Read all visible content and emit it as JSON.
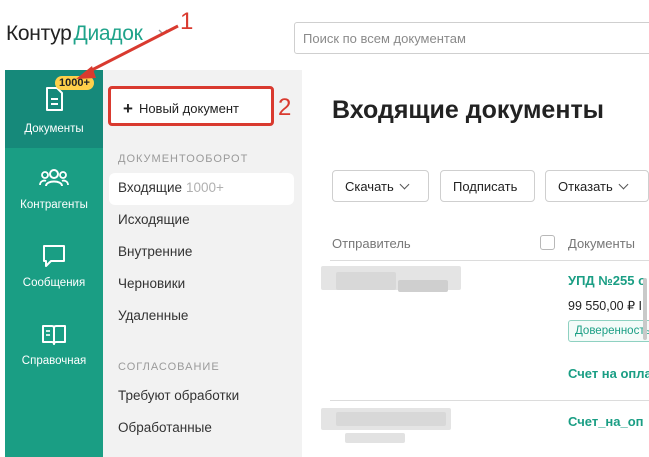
{
  "header": {
    "logo_kontur": "Контур",
    "logo_diadoc": "Диадок",
    "search_placeholder": "Поиск по всем документам"
  },
  "sidebar": {
    "items": [
      {
        "label": "Документы",
        "badge": "1000+",
        "icon": "document-icon"
      },
      {
        "label": "Контрагенты",
        "icon": "users-icon"
      },
      {
        "label": "Сообщения",
        "icon": "message-icon"
      },
      {
        "label": "Справочная",
        "icon": "book-icon"
      }
    ]
  },
  "subnav": {
    "new_document": "Новый документ",
    "section_docflow": "ДОКУМЕНТООБОРОТ",
    "docflow_items": [
      {
        "label": "Входящие",
        "count": "1000+"
      },
      {
        "label": "Исходящие"
      },
      {
        "label": "Внутренние"
      },
      {
        "label": "Черновики"
      },
      {
        "label": "Удаленные"
      }
    ],
    "section_approval": "СОГЛАСОВАНИЕ",
    "approval_items": [
      {
        "label": "Требуют обработки"
      },
      {
        "label": "Обработанные"
      }
    ]
  },
  "main": {
    "title": "Входящие документы",
    "toolbar": {
      "download": "Скачать",
      "sign": "Подписать",
      "reject": "Отказать"
    },
    "columns": {
      "sender": "Отправитель",
      "documents": "Документы"
    },
    "rows": [
      {
        "doc_title": "УПД №255 о",
        "amount": "99 550,00 ₽ I",
        "tag": "Доверенность",
        "doc_title_2": "Счет на опла"
      },
      {
        "doc_title": "Счет_на_оп"
      }
    ]
  },
  "annotations": {
    "one": "1",
    "two": "2"
  },
  "colors": {
    "brand_green": "#1a9e84",
    "badge_yellow": "#ffd04a",
    "annotation_red": "#d93a2f"
  }
}
